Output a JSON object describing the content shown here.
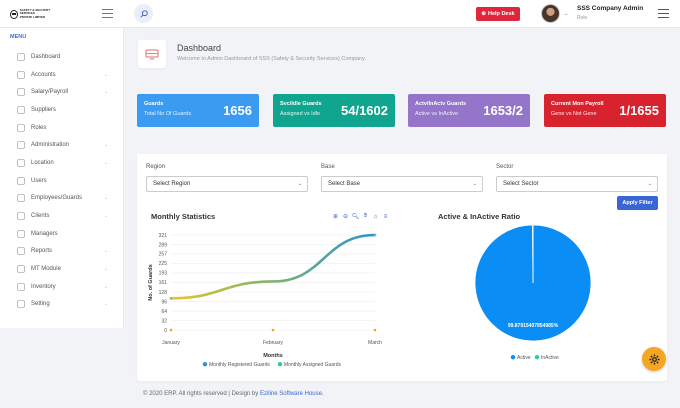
{
  "header": {
    "logo_text_line1": "SAFETY & SECURITY SERVICES",
    "logo_text_line2": "PRIVATE LIMITED",
    "help_label": "Help Desk",
    "user_name": "SSS Company Admin",
    "user_role": "Role"
  },
  "sidebar": {
    "title": "MENU",
    "items": [
      {
        "label": "Dashboard",
        "icon": "dashboard-icon",
        "chevron": false
      },
      {
        "label": "Accounts",
        "icon": "accounts-icon",
        "chevron": true
      },
      {
        "label": "Salary/Payroll",
        "icon": "payroll-icon",
        "chevron": true
      },
      {
        "label": "Suppliers",
        "icon": "suppliers-icon",
        "chevron": false
      },
      {
        "label": "Roles",
        "icon": "roles-icon",
        "chevron": false
      },
      {
        "label": "Administration",
        "icon": "administration-icon",
        "chevron": true
      },
      {
        "label": "Location",
        "icon": "location-icon",
        "chevron": true
      },
      {
        "label": "Users",
        "icon": "users-icon",
        "chevron": false
      },
      {
        "label": "Employees/Guards",
        "icon": "employees-icon",
        "chevron": true
      },
      {
        "label": "Clients",
        "icon": "clients-icon",
        "chevron": true
      },
      {
        "label": "Managers",
        "icon": "managers-icon",
        "chevron": false
      },
      {
        "label": "Reports",
        "icon": "reports-icon",
        "chevron": true
      },
      {
        "label": "MT Module",
        "icon": "module-icon",
        "chevron": true
      },
      {
        "label": "Inventory",
        "icon": "inventory-icon",
        "chevron": true
      },
      {
        "label": "Setting",
        "icon": "setting-icon",
        "chevron": true
      }
    ]
  },
  "page": {
    "title": "Dashboard",
    "subtitle": "Welcome to Admin Dashboard of SSS (Safety & Security Services) Company."
  },
  "cards": [
    {
      "title": "Guards",
      "subtitle": "Total No Of Guards",
      "value": "1656",
      "color": "#3a9bf0"
    },
    {
      "title": "Svc/Idle Guards",
      "subtitle": "Assigned vs Idle",
      "value": "54/1602",
      "color": "#10a58f"
    },
    {
      "title": "Actv/InActv Guards",
      "subtitle": "Active vs InActive",
      "value": "1653/2",
      "color": "#9475c9"
    },
    {
      "title": "Current Mon Payroll",
      "subtitle": "Gene vs Not Gene",
      "value": "1/1655",
      "color": "#d8232f"
    }
  ],
  "filters": {
    "region_label": "Region",
    "region_value": "Select Region",
    "base_label": "Base",
    "base_value": "Select Base",
    "sector_label": "Sector",
    "sector_value": "Select Sector",
    "apply_label": "Apply Filter"
  },
  "charts": {
    "line_title": "Monthly Statistics",
    "pie_title": "Active & InActive Ratio"
  },
  "chart_data": [
    {
      "type": "line",
      "title": "Monthly Statistics",
      "categories": [
        "January",
        "February",
        "March"
      ],
      "xlabel": "Months",
      "ylabel": "No. of Guards",
      "yticks": [
        0,
        32,
        64,
        96,
        128,
        161,
        193,
        225,
        257,
        289,
        321
      ],
      "ylim": [
        0,
        321
      ],
      "series": [
        {
          "name": "Monthly Registered Guards",
          "values": [
            107,
            164,
            321
          ],
          "color": "#2b92d6"
        },
        {
          "name": "Monthly Assigned Guards",
          "values": [
            0,
            0,
            0
          ],
          "color": "#f0a020"
        }
      ],
      "grid": true,
      "legend": "bottom"
    },
    {
      "type": "pie",
      "title": "Active & InActive Ratio",
      "labels": [
        "Active",
        "InActive"
      ],
      "values": [
        99.87915407854985,
        0.12084592145015
      ],
      "colors": [
        "#0a8df5",
        "#2fd08a"
      ],
      "data_label": "99.87915407854985%",
      "legend": "bottom"
    }
  ],
  "footer": {
    "text": "© 2020 ERP. All rights reserved | Design by",
    "link": "Eziline Software House."
  }
}
